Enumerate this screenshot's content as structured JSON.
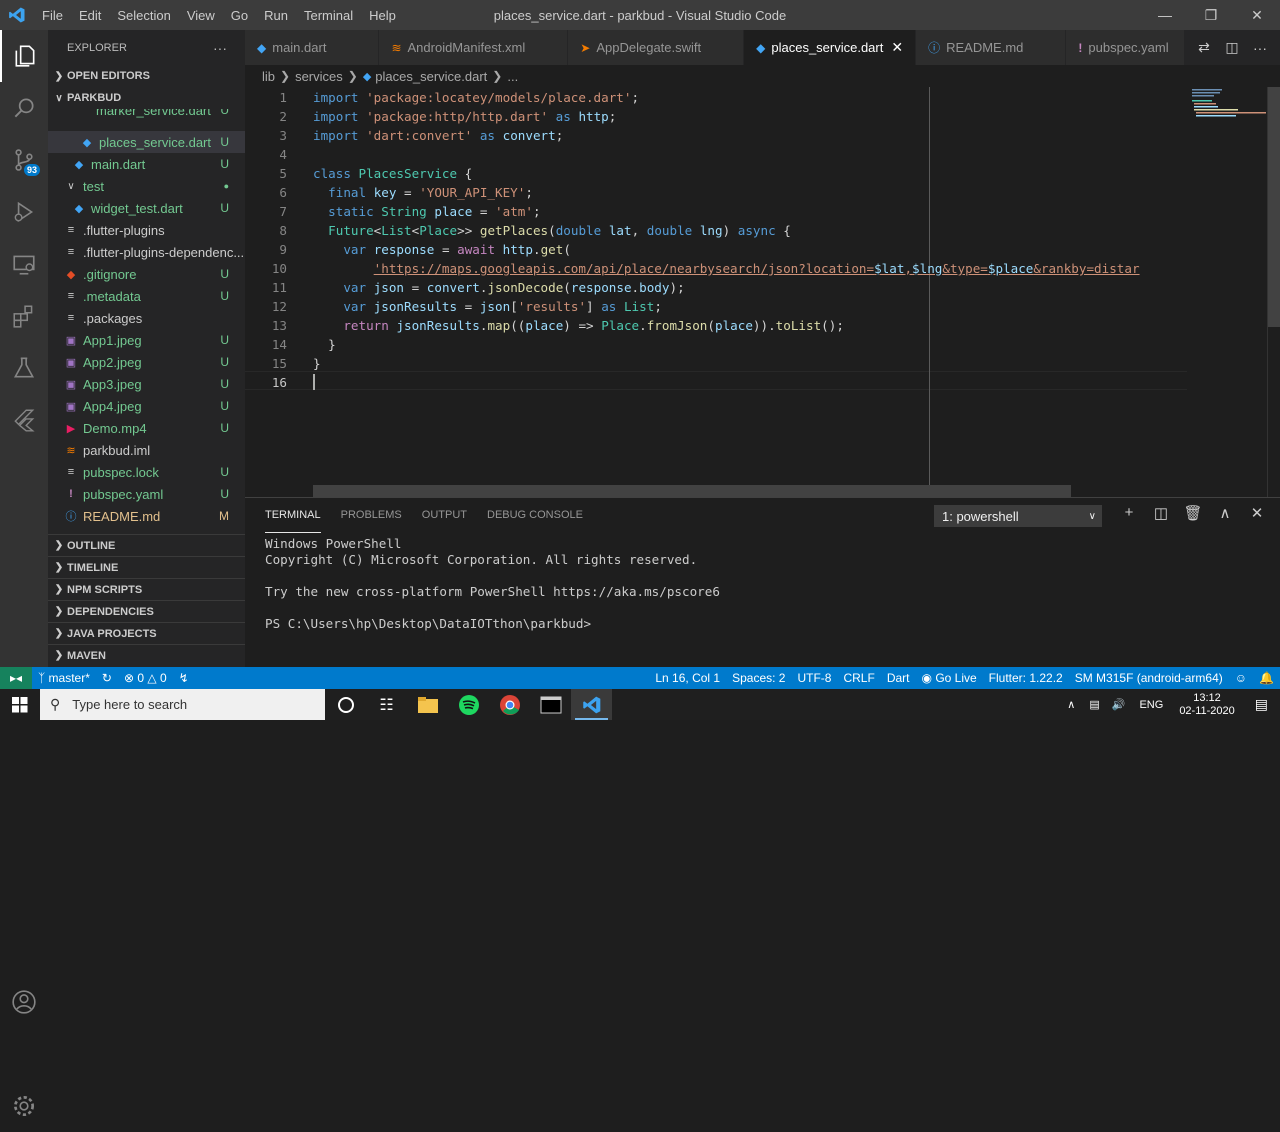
{
  "window": {
    "title": "places_service.dart - parkbud - Visual Studio Code",
    "menu": [
      "File",
      "Edit",
      "Selection",
      "View",
      "Go",
      "Run",
      "Terminal",
      "Help"
    ]
  },
  "activity": {
    "scm_badge": "93"
  },
  "sidebar": {
    "header": "EXPLORER",
    "open_editors": "OPEN EDITORS",
    "project": "PARKBUD",
    "files": [
      {
        "name": "marker_service.dart",
        "status": "U"
      },
      {
        "name": "places_service.dart",
        "status": "U"
      },
      {
        "name": "main.dart",
        "status": "U"
      },
      {
        "name": "test",
        "status": ""
      },
      {
        "name": "widget_test.dart",
        "status": "U"
      },
      {
        "name": ".flutter-plugins",
        "status": ""
      },
      {
        "name": ".flutter-plugins-dependenc...",
        "status": ""
      },
      {
        "name": ".gitignore",
        "status": "U"
      },
      {
        "name": ".metadata",
        "status": "U"
      },
      {
        "name": ".packages",
        "status": ""
      },
      {
        "name": "App1.jpeg",
        "status": "U"
      },
      {
        "name": "App2.jpeg",
        "status": "U"
      },
      {
        "name": "App3.jpeg",
        "status": "U"
      },
      {
        "name": "App4.jpeg",
        "status": "U"
      },
      {
        "name": "Demo.mp4",
        "status": "U"
      },
      {
        "name": "parkbud.iml",
        "status": ""
      },
      {
        "name": "pubspec.lock",
        "status": "U"
      },
      {
        "name": "pubspec.yaml",
        "status": "U"
      },
      {
        "name": "README.md",
        "status": "M"
      }
    ],
    "sections": [
      "OUTLINE",
      "TIMELINE",
      "NPM SCRIPTS",
      "DEPENDENCIES",
      "JAVA PROJECTS",
      "MAVEN"
    ]
  },
  "tabs": [
    {
      "label": "main.dart",
      "active": false
    },
    {
      "label": "AndroidManifest.xml",
      "active": false
    },
    {
      "label": "AppDelegate.swift",
      "active": false
    },
    {
      "label": "places_service.dart",
      "active": true
    },
    {
      "label": "README.md",
      "active": false
    },
    {
      "label": "pubspec.yaml",
      "active": false
    }
  ],
  "breadcrumb": [
    "lib",
    "services",
    "places_service.dart",
    "..."
  ],
  "editor": {
    "line_numbers": [
      "1",
      "2",
      "3",
      "4",
      "5",
      "6",
      "7",
      "8",
      "9",
      "10",
      "11",
      "12",
      "13",
      "14",
      "15",
      "16"
    ],
    "lines": [
      "import 'package:locatey/models/place.dart';",
      "import 'package:http/http.dart' as http;",
      "import 'dart:convert' as convert;",
      "",
      "class PlacesService {",
      "  final key = 'YOUR_API_KEY';",
      "  static String place = 'atm';",
      "  Future<List<Place>> getPlaces(double lat, double lng) async {",
      "    var response = await http.get(",
      "        'https://maps.googleapis.com/api/place/nearbysearch/json?location=$lat,$lng&type=$place&rankby=distar",
      "    var json = convert.jsonDecode(response.body);",
      "    var jsonResults = json['results'] as List;",
      "    return jsonResults.map((place) => Place.fromJson(place)).toList();",
      "  }",
      "}",
      ""
    ]
  },
  "panel": {
    "tabs": [
      "TERMINAL",
      "PROBLEMS",
      "OUTPUT",
      "DEBUG CONSOLE"
    ],
    "terminal_select": "1: powershell",
    "terminal_lines": [
      "Windows PowerShell",
      "Copyright (C) Microsoft Corporation. All rights reserved.",
      "",
      "Try the new cross-platform PowerShell https://aka.ms/pscore6",
      "",
      "PS C:\\Users\\hp\\Desktop\\DataIOTthon\\parkbud>"
    ]
  },
  "status": {
    "branch": "master*",
    "errors": "0",
    "warnings": "0",
    "position": "Ln 16, Col 1",
    "spaces": "Spaces: 2",
    "encoding": "UTF-8",
    "eol": "CRLF",
    "language": "Dart",
    "golive": "Go Live",
    "flutter": "Flutter: 1.22.2",
    "device": "SM M315F (android-arm64)"
  },
  "taskbar": {
    "search_placeholder": "Type here to search",
    "lang": "ENG",
    "time": "13:12",
    "date": "02-11-2020"
  },
  "colors": {
    "accent": "#007acc",
    "statusbar": "#007acc",
    "untracked": "#73c991",
    "modified": "#e2c08d"
  }
}
